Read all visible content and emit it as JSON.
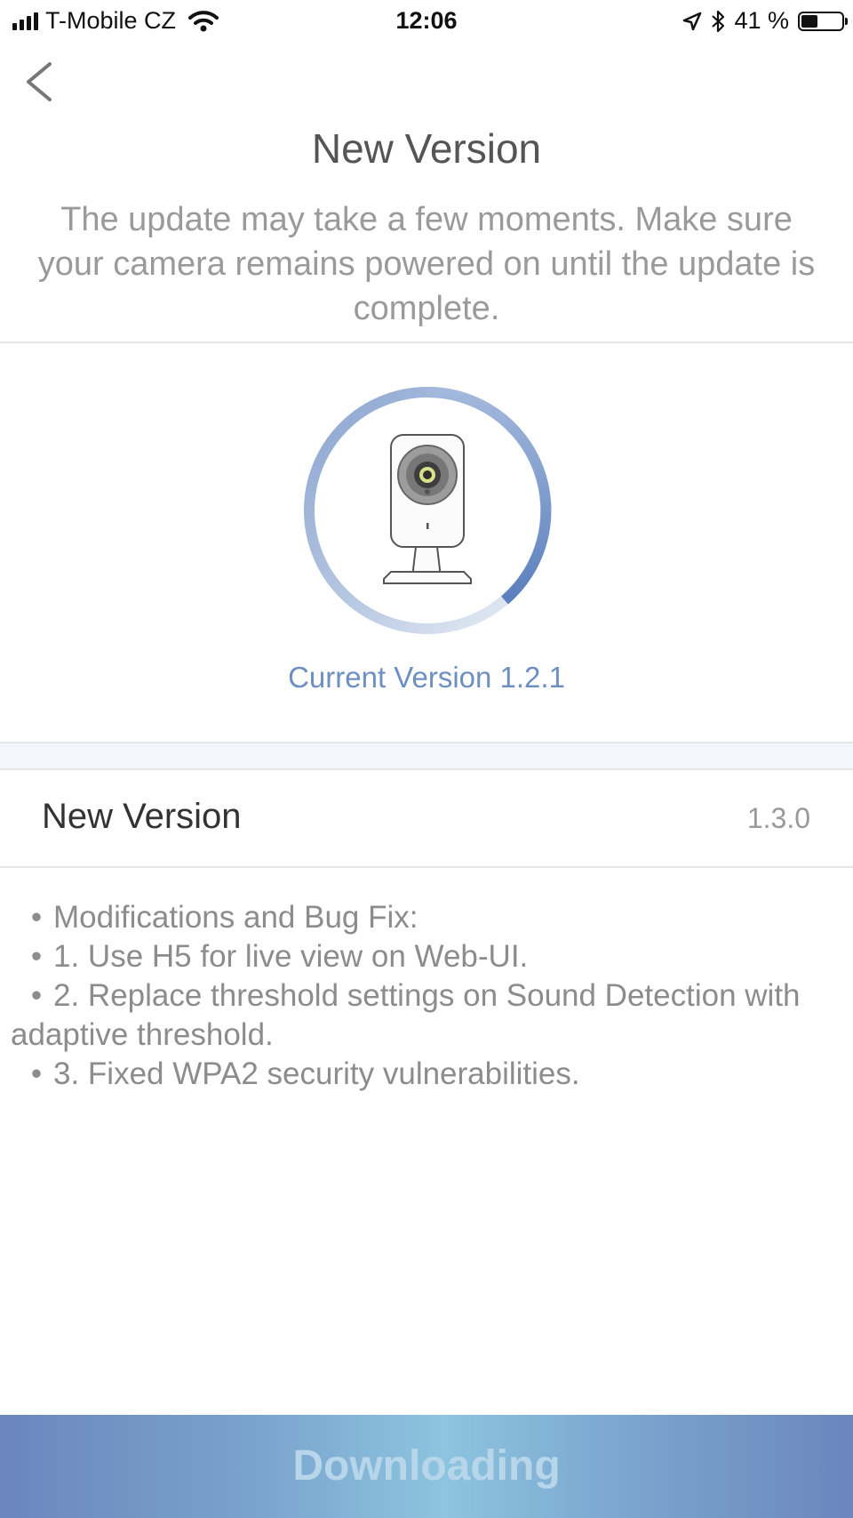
{
  "status_bar": {
    "carrier": "T-Mobile CZ",
    "time": "12:06",
    "battery": "41 %",
    "battery_level": 0.41,
    "icons": [
      "signal-icon",
      "wifi-icon",
      "location-icon",
      "bluetooth-icon",
      "battery-icon"
    ]
  },
  "header": {
    "back_icon": "chevron-left-icon",
    "title": "New Version",
    "subtitle": "The update may take a few moments. Make sure your camera remains powered on until the update is complete."
  },
  "progress": {
    "illustration": "camera-icon",
    "current_version": "Current Version 1.2.1"
  },
  "version_row": {
    "label": "New Version",
    "value": "1.3.0"
  },
  "release_notes": [
    "Modifications and Bug Fix:",
    "1. Use H5 for live view on Web-UI.",
    "2. Replace threshold settings on Sound Detection with adaptive threshold.",
    "3. Fixed WPA2 security vulnerabilities."
  ],
  "footer": {
    "button_label": "Downloading"
  },
  "colors": {
    "accent": "#6d8fc1",
    "button_gradient_mid": "#8dc4df"
  }
}
